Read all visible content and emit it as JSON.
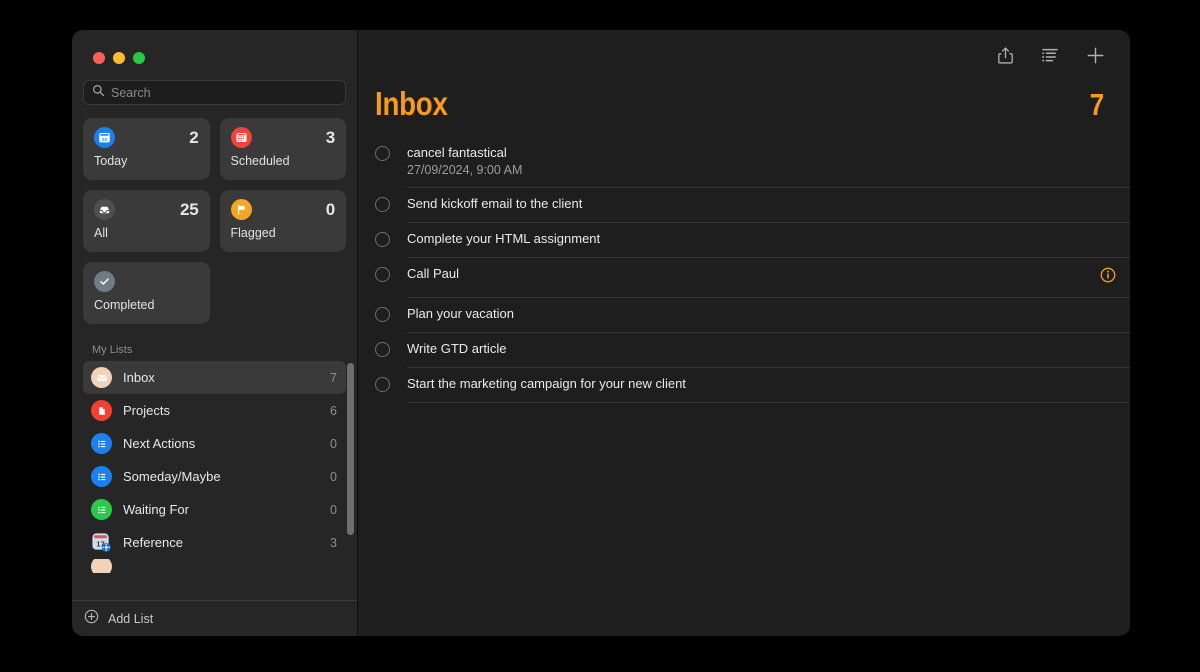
{
  "window": {
    "traffic_lights": [
      {
        "name": "close",
        "color": "#ff5f57"
      },
      {
        "name": "minimize",
        "color": "#febc2e"
      },
      {
        "name": "maximize",
        "color": "#28c840"
      }
    ]
  },
  "sidebar": {
    "search": {
      "value": "",
      "placeholder": "Search"
    },
    "smart_cards": [
      {
        "label": "Today",
        "count": "2",
        "icon": "calendar-day-icon",
        "icon_color": "#1a81ef"
      },
      {
        "label": "Scheduled",
        "count": "3",
        "icon": "calendar-icon",
        "icon_color": "#f04438"
      },
      {
        "label": "All",
        "count": "25",
        "icon": "tray-icon",
        "icon_color": "#4f4f4f"
      },
      {
        "label": "Flagged",
        "count": "0",
        "icon": "flag-icon",
        "icon_color": "#f5a623"
      },
      {
        "label": "Completed",
        "count": "",
        "icon": "checkmark-icon",
        "icon_color": "#6e7d84"
      }
    ],
    "mylists_header": "My Lists",
    "lists": [
      {
        "label": "Inbox",
        "count": "7",
        "icon": "envelope-icon",
        "icon_color": "#f2d3ba",
        "selected": true
      },
      {
        "label": "Projects",
        "count": "6",
        "icon": "document-icon",
        "icon_color": "#f53f31",
        "selected": false
      },
      {
        "label": "Next Actions",
        "count": "0",
        "icon": "list-icon",
        "icon_color": "#1a81ef",
        "selected": false
      },
      {
        "label": "Someday/Maybe",
        "count": "0",
        "icon": "list-icon",
        "icon_color": "#1a81ef",
        "selected": false
      },
      {
        "label": "Waiting For",
        "count": "0",
        "icon": "list-icon",
        "icon_color": "#2cc84d",
        "selected": false
      },
      {
        "label": "Reference",
        "count": "3",
        "icon": "calendar-app-icon",
        "icon_color": "#c9d9ef",
        "selected": false
      }
    ],
    "add_list_label": "Add List"
  },
  "toolbar": {
    "share_label": "Share",
    "sort_label": "List Options",
    "add_label": "Add Reminder"
  },
  "content": {
    "title": "Inbox",
    "total": "7",
    "accent_color": "#f79a1e",
    "tasks": [
      {
        "title": "cancel fantastical",
        "subtitle": "27/09/2024, 9:00 AM",
        "info": false
      },
      {
        "title": "Send kickoff email to the client",
        "subtitle": "",
        "info": false
      },
      {
        "title": "Complete your HTML assignment",
        "subtitle": "",
        "info": false
      },
      {
        "title": "Call Paul",
        "subtitle": "",
        "info": true
      },
      {
        "title": "Plan your vacation",
        "subtitle": "",
        "info": false
      },
      {
        "title": "Write GTD article",
        "subtitle": "",
        "info": false
      },
      {
        "title": "Start the marketing campaign for your new client",
        "subtitle": "",
        "info": false
      }
    ]
  }
}
